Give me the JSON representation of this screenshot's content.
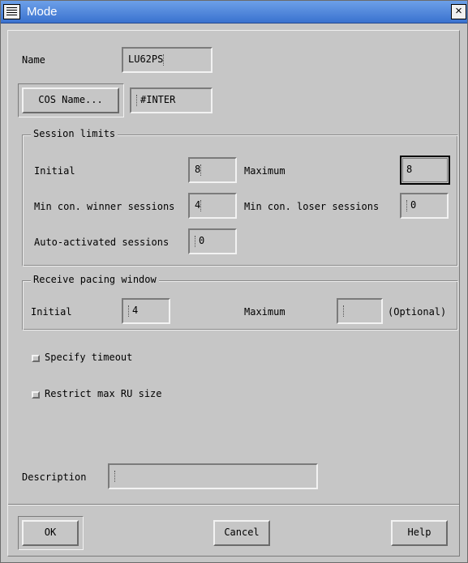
{
  "window": {
    "title": "Mode",
    "close_glyph": "×",
    "menu_icon": "window-menu-icon"
  },
  "name": {
    "label": "Name",
    "value": "LU62PS"
  },
  "cos": {
    "button_label": "COS Name...",
    "value": "#INTER"
  },
  "session_limits": {
    "title": "Session limits",
    "initial_label": "Initial",
    "initial_value": "8",
    "maximum_label": "Maximum",
    "maximum_value": "8",
    "min_winner_label": "Min con. winner sessions",
    "min_winner_value": "4",
    "min_loser_label": "Min con. loser sessions",
    "min_loser_value": "0",
    "auto_label": "Auto-activated sessions",
    "auto_value": "0"
  },
  "pacing": {
    "title": "Receive pacing window",
    "initial_label": "Initial",
    "initial_value": "4",
    "maximum_label": "Maximum",
    "maximum_value": "",
    "optional_label": "(Optional)"
  },
  "options": {
    "specify_timeout_label": "Specify timeout",
    "restrict_ru_label": "Restrict max RU size"
  },
  "description": {
    "label": "Description",
    "value": ""
  },
  "buttons": {
    "ok": "OK",
    "cancel": "Cancel",
    "help": "Help"
  }
}
